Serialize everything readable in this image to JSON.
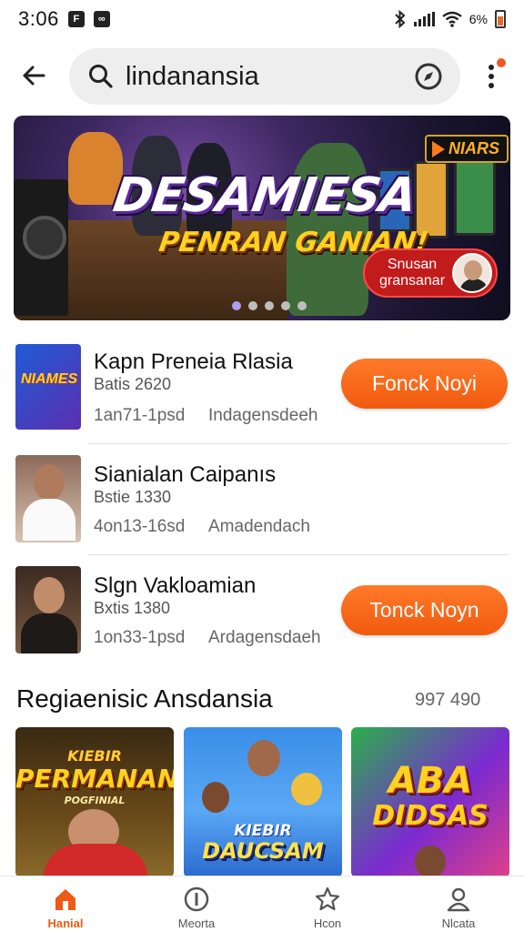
{
  "status_bar": {
    "time": "3:06",
    "icon_a": "F",
    "icon_b": "∞",
    "battery_text": "6%"
  },
  "search": {
    "query": "lindanansia"
  },
  "banner": {
    "title_main": "DESAMIESA",
    "title_sub": "PENRAN GANIAN!",
    "tag_label": "NIARS",
    "promo_text": "Snusan gransanar",
    "slides": 5,
    "active_slide": 1
  },
  "apps": [
    {
      "title": "Kapn Preneia Rlasia",
      "subtitle": "Batis 2620",
      "meta_a": "1an71-1psd",
      "meta_b": "Indagensdeeh",
      "cta": "Fonck Noyi",
      "thumb_text": "NIAMES"
    },
    {
      "title": "Sianialan Caipanıs",
      "subtitle": "Bstie 1330",
      "meta_a": "4on13-16sd",
      "meta_b": "Amadendach",
      "cta": ""
    },
    {
      "title": "Slgn Vakloamian",
      "subtitle": "Bxtis 1380",
      "meta_a": "1on33-1psd",
      "meta_b": "Ardagensdaeh",
      "cta": "Tonck Noyn"
    }
  ],
  "section": {
    "title": "Regiaenisic Ansdansia",
    "count": "997 490"
  },
  "cards": [
    {
      "title": "PERMANAN",
      "top": "KIEBIR",
      "bottom": "POGFINIAL"
    },
    {
      "title": "DAUCSAM",
      "top": "KIEBIR",
      "bottom": ""
    },
    {
      "title": "DIDSAS",
      "top": "ABA",
      "bottom": ""
    }
  ],
  "nav": [
    {
      "label": "Hanial",
      "icon": "home-icon",
      "active": true
    },
    {
      "label": "Meorta",
      "icon": "info-icon",
      "active": false
    },
    {
      "label": "Hcon",
      "icon": "star-icon",
      "active": false
    },
    {
      "label": "Nlcata",
      "icon": "profile-icon",
      "active": false
    }
  ],
  "colors": {
    "accent": "#f15a0e",
    "search_bg": "#eeeeee",
    "promo_red": "#c21b1b",
    "title_yellow": "#ffd21f"
  }
}
